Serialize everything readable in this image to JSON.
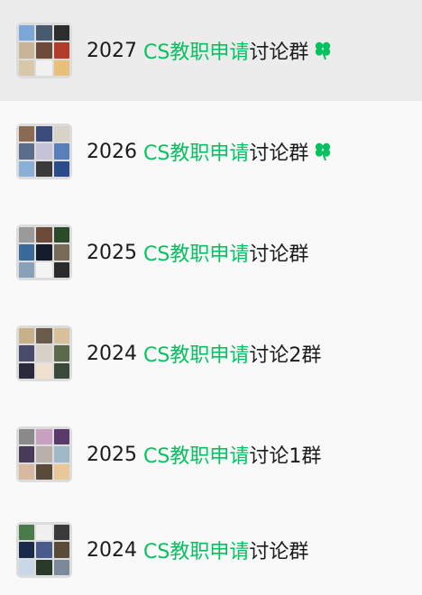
{
  "accent": "#07c160",
  "chats": [
    {
      "year": "2027",
      "keyword": "CS教职申请",
      "suffix": "讨论群",
      "pinned_icon": "four-leaf-clover-icon",
      "selected": true,
      "tiles": [
        "#7aa7d8",
        "#4a5a6e",
        "#2d2d2d",
        "#c9b49a",
        "#6d4b3b",
        "#b33b2a",
        "#d8c7a8",
        "#f1f1f1",
        "#e8c07a"
      ]
    },
    {
      "year": "2026",
      "keyword": "CS教职申请",
      "suffix": "讨论群",
      "pinned_icon": "four-leaf-clover-icon",
      "selected": false,
      "tiles": [
        "#8a6a52",
        "#3b4c7a",
        "#d9d2c8",
        "#5b6c8c",
        "#c8c2d8",
        "#5a7fb8",
        "#8ab0d8",
        "#3a3a3a",
        "#2b4c8a"
      ]
    },
    {
      "year": "2025",
      "keyword": "CS教职申请",
      "suffix": "讨论群",
      "pinned_icon": "",
      "selected": false,
      "tiles": [
        "#9a9a9a",
        "#6b4a3a",
        "#2a4a2a",
        "#3a6a9a",
        "#141c2c",
        "#7a6a5a",
        "#8aa0b8",
        "#f4f4f4",
        "#2a2a2a"
      ]
    },
    {
      "year": "2024",
      "keyword": "CS教职申请",
      "suffix": "讨论2群",
      "pinned_icon": "",
      "selected": false,
      "tiles": [
        "#c8b08a",
        "#6a5a4a",
        "#d8c09a",
        "#4a4a6a",
        "#d8d0c8",
        "#5a6a4a",
        "#2a2a3a",
        "#f0e0d0",
        "#3a4a3a"
      ]
    },
    {
      "year": "2025",
      "keyword": "CS教职申请",
      "suffix": "讨论1群",
      "pinned_icon": "",
      "selected": false,
      "tiles": [
        "#8a8a8a",
        "#c8a0c0",
        "#5a3a6a",
        "#4a3a5a",
        "#b8b0a8",
        "#a0b8c8",
        "#d8b8a0",
        "#5a4a3a",
        "#e8c898"
      ]
    },
    {
      "year": "2024",
      "keyword": "CS教职申请",
      "suffix": "讨论群",
      "pinned_icon": "",
      "selected": false,
      "tiles": [
        "#4a7a4a",
        "#f0f0f0",
        "#3a3a3a",
        "#1a2a4a",
        "#4a5a8a",
        "#5a4a3a",
        "#c8d8e8",
        "#2a3a2a",
        "#7a8a9a"
      ]
    }
  ]
}
